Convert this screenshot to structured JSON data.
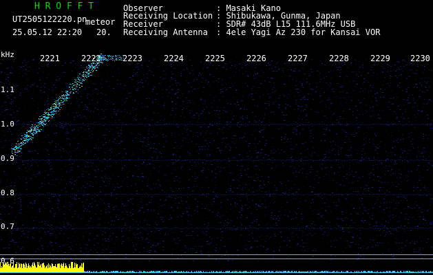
{
  "header": {
    "brand": "H R O F F T",
    "filename": "UT2505122220.pn",
    "mode": "meteor",
    "datetime": "25.05.12 22:20",
    "counter": "20."
  },
  "info": {
    "observer_label": "Observer",
    "observer_value": ": Masaki Kano",
    "location_label": "Receiving Location",
    "location_value": ": Shibukawa, Gunma, Japan",
    "receiver_label": "Receiver",
    "receiver_value": ": SDR# 43dB L15 111.6MHz USB",
    "antenna_label": "Receiving Antenna",
    "antenna_value": ": 4ele Yagi Az 230 for Kansai VOR"
  },
  "axis": {
    "unit": "kHz",
    "y_ticks": [
      "1.1",
      "1.0",
      "0.9",
      "0.8",
      "0.7",
      "0.6"
    ],
    "time_labels": [
      "2221",
      "2222",
      "2223",
      "2224",
      "2225",
      "2226",
      "2227",
      "2228",
      "2229",
      "2230"
    ]
  },
  "colors": {
    "background": "#000000",
    "brand": "#00e000",
    "text": "#ffffff",
    "noise": "#16228a",
    "echo": "#22c8ff",
    "level_bar": "#ffff00",
    "baseline": "#3fd0ff"
  }
}
